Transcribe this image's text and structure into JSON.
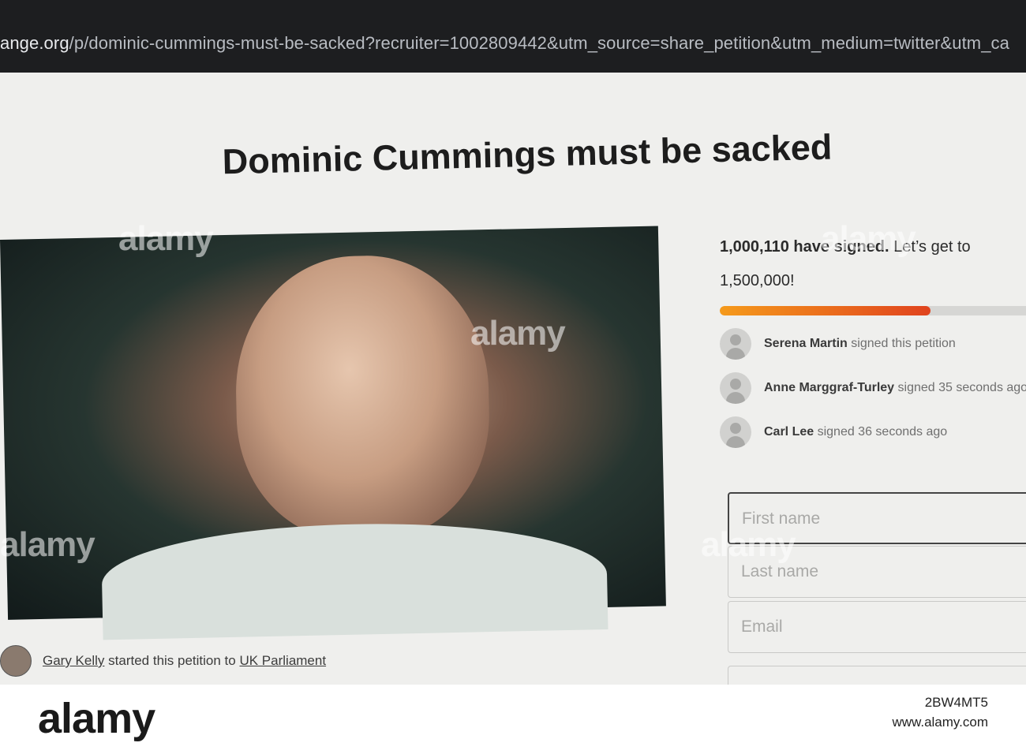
{
  "browser": {
    "url_domain": "ange.org",
    "url_path": "/p/dominic-cummings-must-be-sacked?recruiter=1002809442&utm_source=share_petition&utm_medium=twitter&utm_ca"
  },
  "petition": {
    "title": "Dominic Cummings must be sacked",
    "signed_count": "1,000,110 have signed.",
    "goal_text": " Let’s get to 1,500,000!",
    "progress_fraction": 0.667,
    "progress_colors": {
      "start": "#f59a1b",
      "end": "#e0431e"
    }
  },
  "recent_signers": [
    {
      "name": "Serena Martin",
      "action": " signed this petition"
    },
    {
      "name": "Anne Marggraf-Turley",
      "action": " signed 35 seconds ago"
    },
    {
      "name": "Carl Lee",
      "action": " signed 36 seconds ago"
    }
  ],
  "form": {
    "first_name_placeholder": "First name",
    "last_name_placeholder": "Last name",
    "email_placeholder": "Email"
  },
  "byline": {
    "creator": "Gary Kelly",
    "middle": " started this petition to ",
    "target": "UK Parliament"
  },
  "watermark": {
    "text": "alamy",
    "image_id": "2BW4MT5",
    "site": "www.alamy.com"
  }
}
